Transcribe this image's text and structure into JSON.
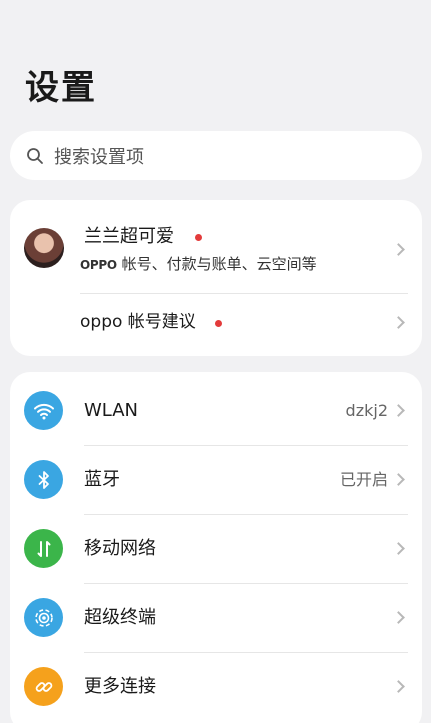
{
  "page": {
    "title": "设置"
  },
  "search": {
    "placeholder": "搜索设置项"
  },
  "account": {
    "name": "兰兰超可爱",
    "subtitle_brand": "OPPO",
    "subtitle_text": " 帐号、付款与账单、云空间等",
    "suggestion": "oppo 帐号建议"
  },
  "network": {
    "items": [
      {
        "label": "WLAN",
        "value": "dzkj2",
        "icon": "wifi-icon",
        "color": "#3aa6e2"
      },
      {
        "label": "蓝牙",
        "value": "已开启",
        "icon": "bluetooth-icon",
        "color": "#3aa6e2"
      },
      {
        "label": "移动网络",
        "value": "",
        "icon": "mobile-data-icon",
        "color": "#3bb54a"
      },
      {
        "label": "超级终端",
        "value": "",
        "icon": "super-terminal-icon",
        "color": "#3aa6e2"
      },
      {
        "label": "更多连接",
        "value": "",
        "icon": "link-icon",
        "color": "#f5a11c"
      }
    ]
  }
}
